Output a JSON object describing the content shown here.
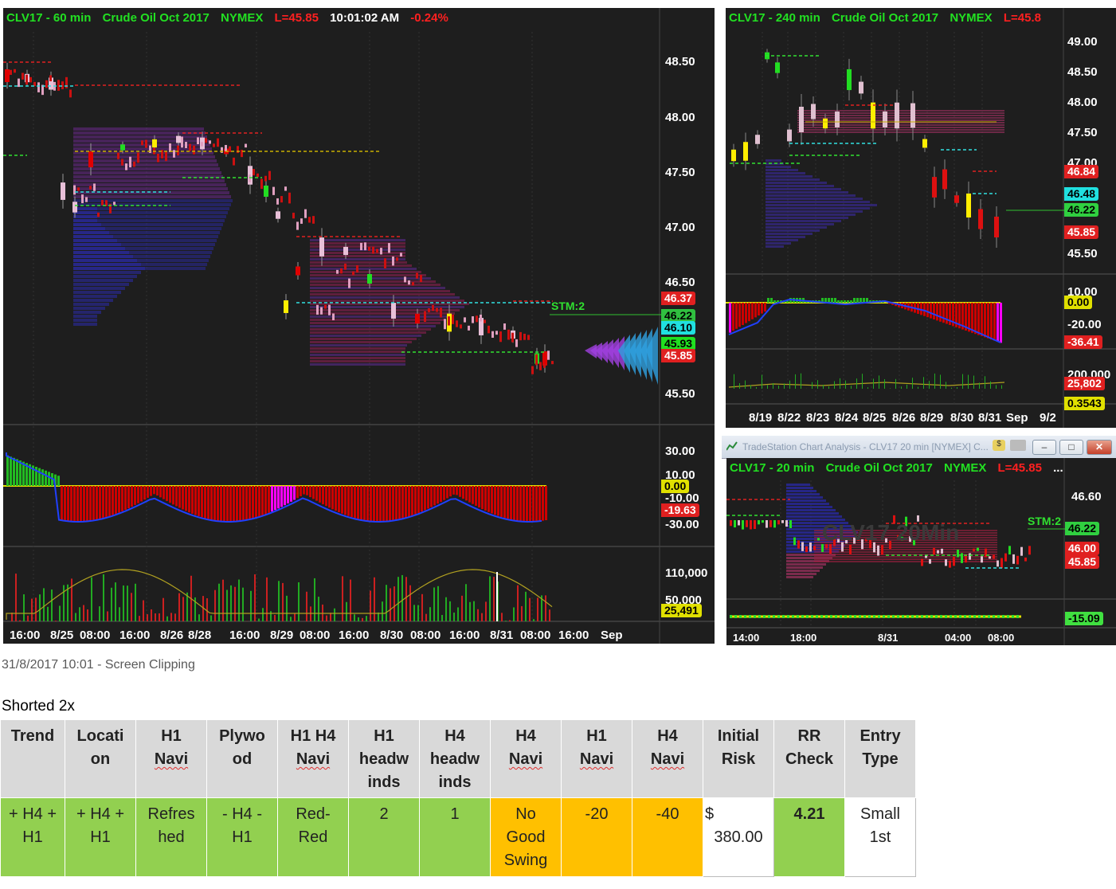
{
  "chart1": {
    "symbol": "CLV17 - 60 min",
    "name": "Crude Oil Oct 2017",
    "exchange": "NYMEX",
    "last": "L=45.85",
    "time": "10:01:02 AM",
    "change": "-0.24%",
    "price_axis": [
      "48.50",
      "48.00",
      "47.50",
      "47.00",
      "46.50",
      "45.50"
    ],
    "price_tags": [
      "46.37",
      "46.22",
      "46.10",
      "45.93",
      "45.85"
    ],
    "stm": "STM:2",
    "ind1_axis": [
      "30.00",
      "10.00",
      "-10.00",
      "-30.00"
    ],
    "ind1_tags": [
      "0.00",
      "-19.63"
    ],
    "ind2_axis": [
      "110,000",
      "50,000"
    ],
    "ind2_tags": [
      "25,491"
    ],
    "time_axis": [
      "16:00",
      "8/25",
      "08:00",
      "16:00",
      "8/26",
      "8/28",
      "16:00",
      "8/29",
      "08:00",
      "16:00",
      "8/30",
      "08:00",
      "16:00",
      "8/31",
      "08:00",
      "16:00",
      "Sep"
    ]
  },
  "chart2": {
    "symbol": "CLV17 - 240 min",
    "name": "Crude Oil Oct 2017",
    "exchange": "NYMEX",
    "last": "L=45.8",
    "price_axis": [
      "49.00",
      "48.50",
      "48.00",
      "47.50",
      "47.00",
      "45.50"
    ],
    "price_tags": [
      "46.84",
      "46.48",
      "46.22",
      "45.85"
    ],
    "ind1_axis": [
      "10.00",
      "-20.00"
    ],
    "ind1_tags": [
      "0.00",
      "-36.41"
    ],
    "ind2_axis": [
      "200,000"
    ],
    "ind2_tags": [
      "25,802",
      "0.3543"
    ],
    "time_axis": [
      "8/19",
      "8/22",
      "8/23",
      "8/24",
      "8/25",
      "8/26",
      "8/29",
      "8/30",
      "8/31",
      "Sep",
      "9/2"
    ]
  },
  "chart3": {
    "window_title": "TradeStation Chart Analysis - CLV17 20 min [NYMEX] C...",
    "symbol": "CLV17 - 20 min",
    "name": "Crude Oil Oct 2017",
    "exchange": "NYMEX",
    "last": "L=45.85",
    "more": "...",
    "price_axis": [
      "46.60"
    ],
    "price_tags": [
      "46.22",
      "46.00",
      "45.85"
    ],
    "stm": "STM:2",
    "ind_tags": [
      "-15.09"
    ],
    "time_axis": [
      "14:00",
      "18:00",
      "8/31",
      "04:00",
      "08:00"
    ],
    "watermark": "CLV17 20Min"
  },
  "clipping_caption": "31/8/2017 10:01 - Screen Clipping",
  "shorted": "Shorted 2x",
  "table": {
    "headers": [
      [
        "Trend"
      ],
      [
        "Locati",
        "on"
      ],
      [
        "H1",
        "Navi"
      ],
      [
        "Plywo",
        "od"
      ],
      [
        "H1 H4",
        "Navi"
      ],
      [
        "H1",
        "headw",
        "inds"
      ],
      [
        "H4",
        "headw",
        "inds"
      ],
      [
        "H4",
        "Navi"
      ],
      [
        "H1",
        "Navi"
      ],
      [
        "H4",
        "Navi"
      ],
      [
        "Initial",
        "Risk"
      ],
      [
        "RR",
        "Check"
      ],
      [
        "Entry",
        "Type"
      ]
    ],
    "row": [
      [
        "+ H4 +",
        "H1"
      ],
      [
        "+ H4 +",
        "H1"
      ],
      [
        "Refres",
        "hed"
      ],
      [
        "- H4 -",
        "H1"
      ],
      [
        "Red-",
        "Red"
      ],
      [
        "2"
      ],
      [
        "1"
      ],
      [
        "No",
        "Good",
        "Swing"
      ],
      [
        "-20"
      ],
      [
        "-40"
      ],
      [
        "$",
        "380.00"
      ],
      [
        "4.21"
      ],
      [
        "Small",
        "1st"
      ]
    ],
    "row_colors": [
      "#92d050",
      "#92d050",
      "#92d050",
      "#92d050",
      "#92d050",
      "#92d050",
      "#92d050",
      "#ffc000",
      "#ffc000",
      "#ffc000",
      "#ffffff",
      "#92d050",
      "#ffffff"
    ]
  }
}
